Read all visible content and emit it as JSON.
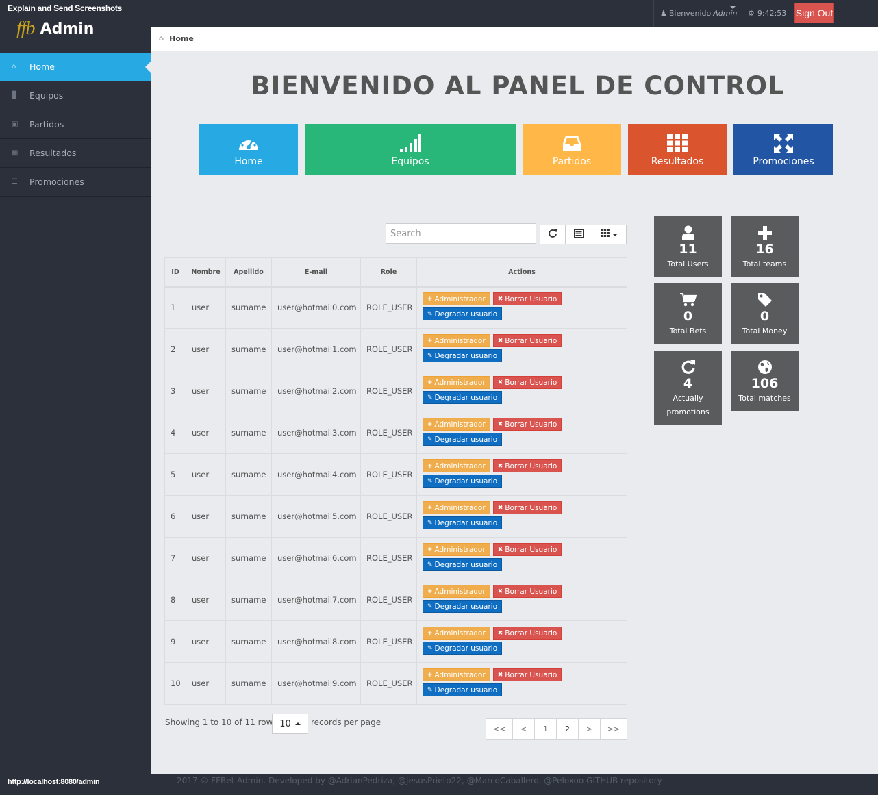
{
  "capture": {
    "title": "Explain and Send Screenshots",
    "status_url": "http://localhost:8080/admin"
  },
  "brand": {
    "logo_mark": "ffb",
    "name": "Admin",
    "logo_color": "#c9a21a"
  },
  "topbar": {
    "welcome": "Bienvenido",
    "user": "Admin",
    "time": "9:42:53",
    "sign_out": "Sign Out"
  },
  "sidebar": {
    "items": [
      {
        "label": "Home",
        "icon": "home-icon",
        "active": true
      },
      {
        "label": "Equipos",
        "icon": "signal-icon",
        "active": false
      },
      {
        "label": "Partidos",
        "icon": "inbox-icon",
        "active": false
      },
      {
        "label": "Resultados",
        "icon": "th-icon",
        "active": false
      },
      {
        "label": "Promociones",
        "icon": "list-icon",
        "active": false
      }
    ]
  },
  "breadcrumb": {
    "label": "Home"
  },
  "page": {
    "title": "BIENVENIDO AL PANEL DE CONTROL"
  },
  "tiles": [
    {
      "label": "Home",
      "icon": "dashboard-icon",
      "color": "#27a9e3"
    },
    {
      "label": "Equipos",
      "icon": "signal-icon",
      "color": "#28b779"
    },
    {
      "label": "Partidos",
      "icon": "inbox-icon",
      "color": "#ffb848"
    },
    {
      "label": "Resultados",
      "icon": "th-icon",
      "color": "#da542e"
    },
    {
      "label": "Promociones",
      "icon": "fullscreen-icon",
      "color": "#2255a4"
    }
  ],
  "table": {
    "search_placeholder": "Search",
    "columns": [
      "ID",
      "Nombre",
      "Apellido",
      "E-mail",
      "Role",
      "Actions"
    ],
    "actions": {
      "promote": "Administrador",
      "delete": "Borrar Usuario",
      "demote": "Degradar usuario"
    },
    "rows": [
      {
        "id": "1",
        "nombre": "user",
        "apellido": "surname",
        "email": "user@hotmail0.com",
        "role": "ROLE_USER"
      },
      {
        "id": "2",
        "nombre": "user",
        "apellido": "surname",
        "email": "user@hotmail1.com",
        "role": "ROLE_USER"
      },
      {
        "id": "3",
        "nombre": "user",
        "apellido": "surname",
        "email": "user@hotmail2.com",
        "role": "ROLE_USER"
      },
      {
        "id": "4",
        "nombre": "user",
        "apellido": "surname",
        "email": "user@hotmail3.com",
        "role": "ROLE_USER"
      },
      {
        "id": "5",
        "nombre": "user",
        "apellido": "surname",
        "email": "user@hotmail4.com",
        "role": "ROLE_USER"
      },
      {
        "id": "6",
        "nombre": "user",
        "apellido": "surname",
        "email": "user@hotmail5.com",
        "role": "ROLE_USER"
      },
      {
        "id": "7",
        "nombre": "user",
        "apellido": "surname",
        "email": "user@hotmail6.com",
        "role": "ROLE_USER"
      },
      {
        "id": "8",
        "nombre": "user",
        "apellido": "surname",
        "email": "user@hotmail7.com",
        "role": "ROLE_USER"
      },
      {
        "id": "9",
        "nombre": "user",
        "apellido": "surname",
        "email": "user@hotmail8.com",
        "role": "ROLE_USER"
      },
      {
        "id": "10",
        "nombre": "user",
        "apellido": "surname",
        "email": "user@hotmail9.com",
        "role": "ROLE_USER"
      }
    ],
    "showing": "Showing 1 to 10 of 11 rows",
    "per_page": "10",
    "records_label": "records per page",
    "pagination": [
      "<<",
      "<",
      "1",
      "2",
      ">",
      ">>"
    ]
  },
  "stats": [
    {
      "value": "11",
      "label": "Total Users",
      "icon": "user-icon"
    },
    {
      "value": "16",
      "label": "Total teams",
      "icon": "plus-icon"
    },
    {
      "value": "0",
      "label": "Total Bets",
      "icon": "shopping-cart-icon"
    },
    {
      "value": "0",
      "label": "Total Money",
      "icon": "tag-icon"
    },
    {
      "value": "4",
      "label": "Actually promotions",
      "icon": "refresh-icon"
    },
    {
      "value": "106",
      "label": "Total matches",
      "icon": "globe-icon"
    }
  ],
  "footer": {
    "text": "2017 © FFBet Admin. Developed by @AdrianPedriza, @JesusPrieto22, @MarcoCaballero, @Peloxoo GITHUB repository"
  }
}
